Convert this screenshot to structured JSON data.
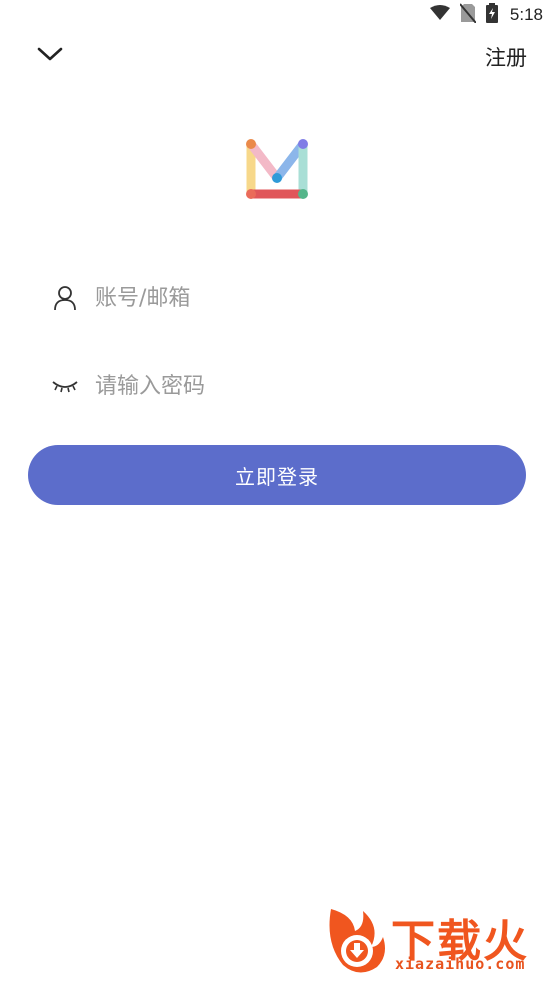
{
  "status_bar": {
    "time": "5:18",
    "icons": [
      "wifi-icon",
      "no-sim-icon",
      "battery-charging-icon"
    ]
  },
  "header": {
    "collapse_icon": "chevron-down-icon",
    "register_label": "注册"
  },
  "logo": {
    "name": "mail-logo"
  },
  "form": {
    "account": {
      "icon": "user-icon",
      "placeholder": "账号/邮箱",
      "value": ""
    },
    "password": {
      "icon": "eye-closed-icon",
      "placeholder": "请输入密码",
      "value": ""
    },
    "login_label": "立即登录"
  },
  "watermark": {
    "brand": "下载火",
    "url": "xiazaihuo.com"
  },
  "colors": {
    "primary": "#5c6dcb",
    "watermark": "#f0561f"
  }
}
